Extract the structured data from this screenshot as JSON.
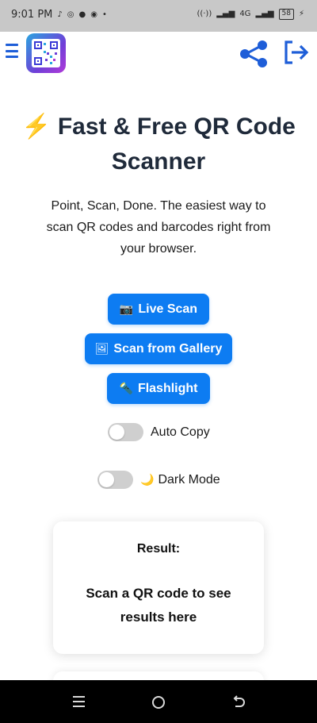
{
  "status_bar": {
    "time": "9:01 PM",
    "battery": "58",
    "network": "4G"
  },
  "header": {
    "menu_icon": "hamburger-menu-icon",
    "logo_icon": "qr-code-logo-icon",
    "share_icon": "share-icon",
    "exit_icon": "exit-icon",
    "accent_color": "#1e5ed8"
  },
  "hero": {
    "title_icon": "⚡",
    "title": "Fast & Free QR Code Scanner",
    "subtitle": "Point, Scan, Done. The easiest way to scan QR codes and barcodes right from your browser."
  },
  "buttons": {
    "live_scan": {
      "icon": "📷",
      "label": "Live Scan"
    },
    "gallery": {
      "icon": "🖼",
      "label": "Scan from Gallery"
    },
    "flashlight": {
      "icon": "🔦",
      "label": "Flashlight"
    },
    "color": "#0d7cf2"
  },
  "toggles": {
    "auto_copy": {
      "label": "Auto Copy",
      "on": false
    },
    "dark_mode": {
      "icon": "🌙",
      "label": "Dark Mode",
      "on": false
    }
  },
  "result": {
    "label": "Result:",
    "text": "Scan a QR code to see results here"
  },
  "nav_bar": {
    "recent_icon": "recent-apps-icon",
    "home_icon": "home-icon",
    "back_icon": "back-icon"
  }
}
